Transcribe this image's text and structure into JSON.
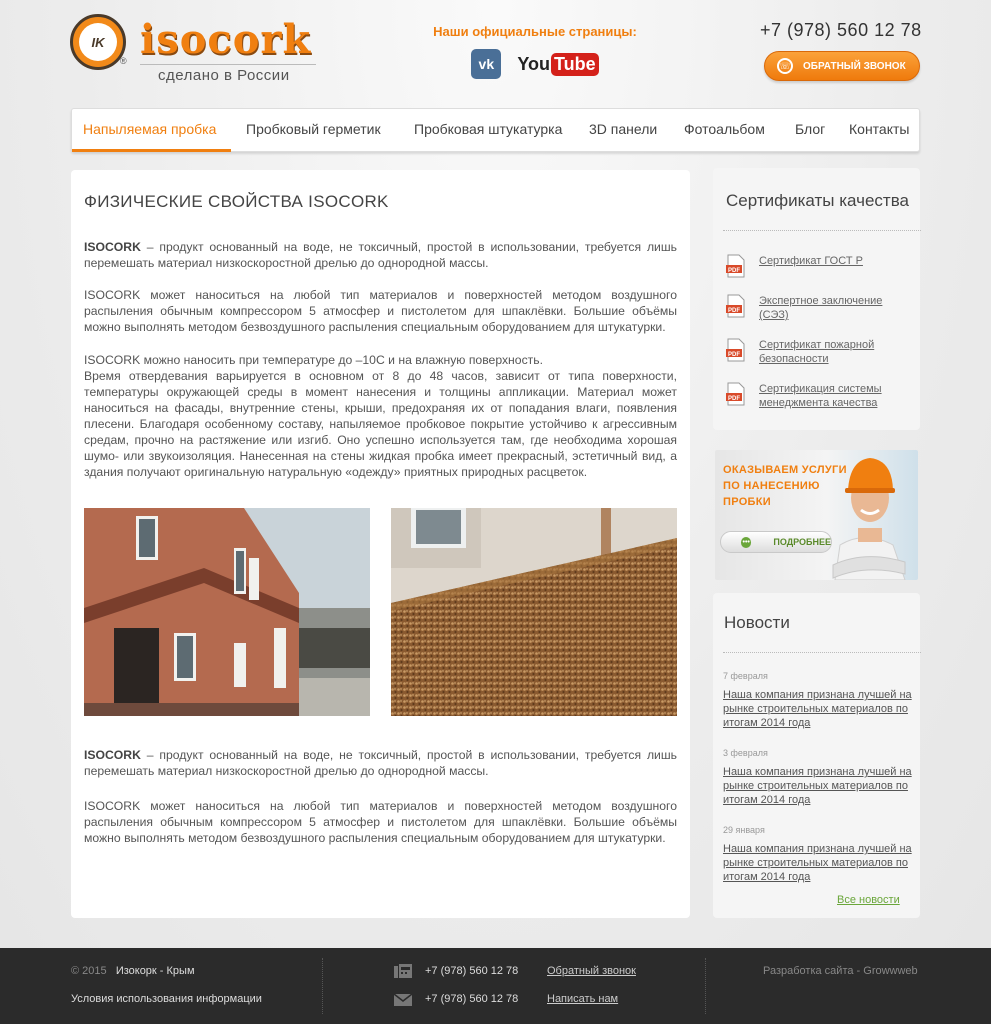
{
  "header": {
    "logo_text": "isocork",
    "logo_badge": "IK",
    "tagline": "сделано в России",
    "official_title": "Наши официальные страницы:",
    "vk_label": "vk",
    "youtube_label": "You",
    "youtube_label2": "Tube",
    "phone": "+7 (978) 560 12 78",
    "callback_label": "ОБРАТНЫЙ ЗВОНОК"
  },
  "nav": {
    "items": [
      {
        "label": "Напыляемая пробка"
      },
      {
        "label": "Пробковый герметик"
      },
      {
        "label": "Пробковая штукатурка"
      },
      {
        "label": "3D панели"
      },
      {
        "label": "Фотоальбом"
      },
      {
        "label": "Блог"
      },
      {
        "label": "Контакты"
      }
    ]
  },
  "main": {
    "title": "ФИЗИЧЕСКИЕ СВОЙСТВА ISOCORK",
    "p1_bold": "ISOCORK",
    "p1_rest": " – продукт основанный на воде, не токсичный, простой в использовании, требуется лишь перемешать материал низкоскоростной дрелью до однородной массы.",
    "p2": "ISOCORK может наноситься на любой тип материалов и поверхностей методом воздушного распыления обычным компрессором 5 атмосфер и пистолетом для шпаклёвки. Большие объёмы можно выполнять методом безвоздушного распыления специальным оборудованием для штукатурки.",
    "p3a": "ISOCORK можно наносить при температуре до –10С и на влажную поверхность.",
    "p3b": "Время отвердевания варьируется в основном от 8 до 48 часов, зависит от типа поверхности, температуры окружающей среды в момент нанесения и толщины аппликации. Материал может наноситься на фасады, внутренние стены, крыши, предохраняя их от попадания влаги, появления плесени. Благодаря особенному составу, напыляемое пробковое покрытие устойчиво к агрессивным средам, прочно на растяжение или изгиб. Оно успешно используется там, где необходима хорошая шумо- или звукоизоляция. Нанесенная на стены жидкая пробка имеет прекрасный, эстетичный вид, а здания получают оригинальную натуральную «одежду» приятных природных расцветок.",
    "p4_bold": "ISOCORK",
    "p4_rest": " – продукт основанный на воде, не токсичный, простой в использовании, требуется лишь перемешать материал низкоскоростной дрелью до однородной массы.",
    "p5": "ISOCORK может наноситься на любой тип материалов и поверхностей методом воздушного распыления обычным компрессором 5 атмосфер и пистолетом для шпаклёвки. Большие объёмы можно выполнять методом безвоздушного распыления специальным оборудованием для штукатурки."
  },
  "certificates": {
    "title": "Сертификаты качества",
    "items": [
      {
        "label": "Сертификат ГОСТ Р"
      },
      {
        "label": "Экспертное заключение (СЭЗ)"
      },
      {
        "label": "Сертификат пожарной безопасности"
      },
      {
        "label": "Сертификация системы менеджмента качества"
      }
    ]
  },
  "promo": {
    "line1": "ОКАЗЫВАЕМ УСЛУГИ",
    "line2": "ПО НАНЕСЕНИЮ",
    "line3": "ПРОБКИ",
    "button": "ПОДРОБНЕЕ",
    "button_icon": "•••"
  },
  "news": {
    "title": "Новости",
    "items": [
      {
        "date": "7 февраля",
        "text": "Наша компания признана лучшей на рынке строительных материалов по итогам 2014 года"
      },
      {
        "date": "3 февраля",
        "text": "Наша компания признана лучшей на рынке строительных материалов по итогам 2014 года"
      },
      {
        "date": "29 января",
        "text": "Наша компания признана лучшей на рынке строительных материалов по итогам 2014 года"
      }
    ],
    "all_link": "Все новости"
  },
  "footer": {
    "copyright": "© 2015",
    "company": "Изокорк - Крым",
    "terms": "Условия использования информации",
    "phone1": "+7 (978) 560 12 78",
    "phone2": "+7 (978) 560 12 78",
    "callback": "Обратный звонок",
    "write": "Написать нам",
    "dev": "Разработка сайта - Growwweb"
  },
  "colors": {
    "accent": "#f07f10",
    "green": "#6aa63a",
    "footer_bg": "#2b2b2b"
  }
}
